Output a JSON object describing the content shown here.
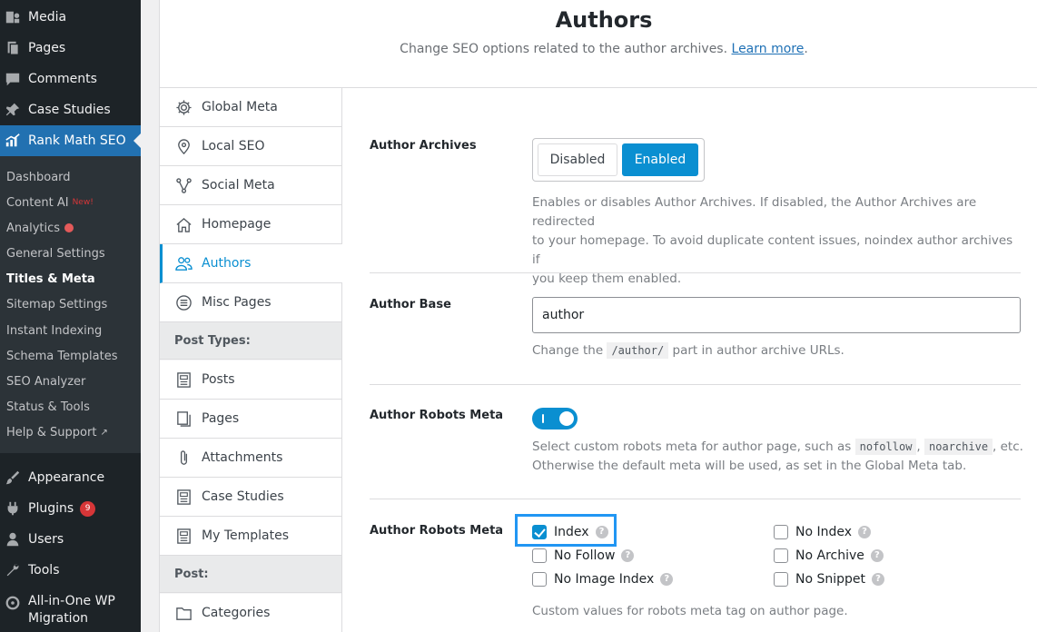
{
  "wp_menu": {
    "media": "Media",
    "pages": "Pages",
    "comments": "Comments",
    "case_studies": "Case Studies",
    "rank_math": "Rank Math SEO",
    "appearance": "Appearance",
    "plugins": "Plugins",
    "plugins_badge": "9",
    "users": "Users",
    "tools": "Tools",
    "aio_line1": "All-in-One WP",
    "aio_line2": "Migration"
  },
  "rank_math_submenu": {
    "dashboard": "Dashboard",
    "content_ai": "Content AI",
    "content_ai_tag": "New!",
    "analytics": "Analytics",
    "general_settings": "General Settings",
    "titles_meta": "Titles & Meta",
    "sitemap_settings": "Sitemap Settings",
    "instant_indexing": "Instant Indexing",
    "schema_templates": "Schema Templates",
    "seo_analyzer": "SEO Analyzer",
    "status_tools": "Status & Tools",
    "help_support": "Help & Support"
  },
  "header": {
    "title": "Authors",
    "subtitle": "Change SEO options related to the author archives.",
    "learn_more": "Learn more",
    "period": "."
  },
  "settings_nav": {
    "global_meta": "Global Meta",
    "local_seo": "Local SEO",
    "social_meta": "Social Meta",
    "homepage": "Homepage",
    "authors": "Authors",
    "misc_pages": "Misc Pages",
    "post_types_heading": "Post Types:",
    "posts": "Posts",
    "pages": "Pages",
    "attachments": "Attachments",
    "case_studies": "Case Studies",
    "my_templates": "My Templates",
    "post_heading": "Post:",
    "categories": "Categories"
  },
  "author_archives": {
    "label": "Author Archives",
    "disabled": "Disabled",
    "enabled": "Enabled",
    "selected": "Enabled",
    "desc_line1": "Enables or disables Author Archives. If disabled, the Author Archives are redirected",
    "desc_line2": "to your homepage. To avoid duplicate content issues, noindex author archives if",
    "desc_line3": "you keep them enabled."
  },
  "author_base": {
    "label": "Author Base",
    "value": "author",
    "desc_before": "Change the",
    "desc_code": "/author/",
    "desc_after": "part in author archive URLs."
  },
  "author_robots_toggle": {
    "label": "Author Robots Meta",
    "state": "on",
    "desc_line1_a": "Select custom robots meta for author page, such as",
    "code1": "nofollow",
    "comma": ",",
    "code2": "noarchive",
    "desc_line1_b": ", etc.",
    "desc_line2": "Otherwise the default meta will be used, as set in the Global Meta tab."
  },
  "author_robots_meta": {
    "label": "Author Robots Meta",
    "options": {
      "index": "Index",
      "no_follow": "No Follow",
      "no_image_index": "No Image Index",
      "no_index": "No Index",
      "no_archive": "No Archive",
      "no_snippet": "No Snippet"
    },
    "checked": [
      "Index"
    ],
    "help_symbol": "?",
    "desc": "Custom values for robots meta tag on author page."
  },
  "colors": {
    "accent": "#0a8fd1",
    "wp_menu_bg": "#1d2327",
    "wp_current": "#2271b1",
    "highlight": "#2196f3"
  }
}
